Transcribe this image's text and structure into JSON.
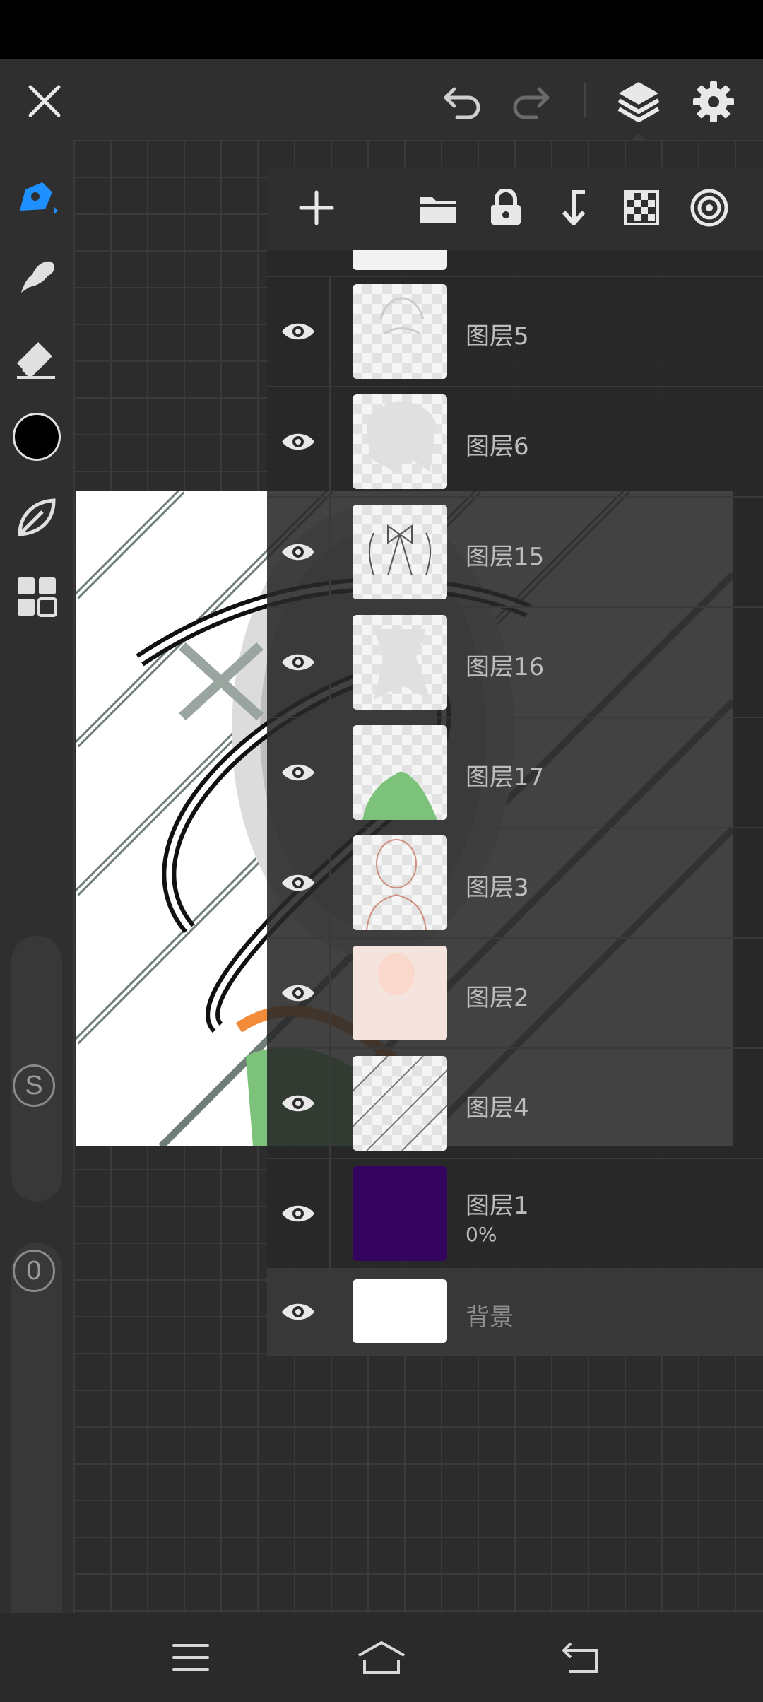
{
  "toolbar": {
    "close_icon": "close-icon",
    "undo_icon": "undo-icon",
    "redo_icon": "redo-icon",
    "layers_icon": "layers-icon",
    "settings_icon": "gear-icon"
  },
  "tools": [
    "pen-icon",
    "smudge-icon",
    "eraser-icon",
    "color-swatch",
    "leaf-icon",
    "grid-icon"
  ],
  "sliders": {
    "size_label": "S",
    "opacity_label": "0"
  },
  "colors": {
    "accent": "#1e90ff",
    "current_color": "#000000",
    "layer1_fill": "#35045f",
    "background_fill": "#ffffff"
  },
  "layer_panel": {
    "actions": [
      "add-layer-icon",
      "folder-icon",
      "lock-icon",
      "merge-down-icon",
      "transparency-icon",
      "target-icon"
    ],
    "layers": [
      {
        "name": "图层5"
      },
      {
        "name": "图层6"
      },
      {
        "name": "图层15"
      },
      {
        "name": "图层16"
      },
      {
        "name": "图层17"
      },
      {
        "name": "图层3"
      },
      {
        "name": "图层2"
      },
      {
        "name": "图层4"
      },
      {
        "name": "图层1",
        "opacity": "0%"
      },
      {
        "name": "背景"
      }
    ]
  },
  "navbar": [
    "menu-icon",
    "home-icon",
    "back-icon"
  ]
}
